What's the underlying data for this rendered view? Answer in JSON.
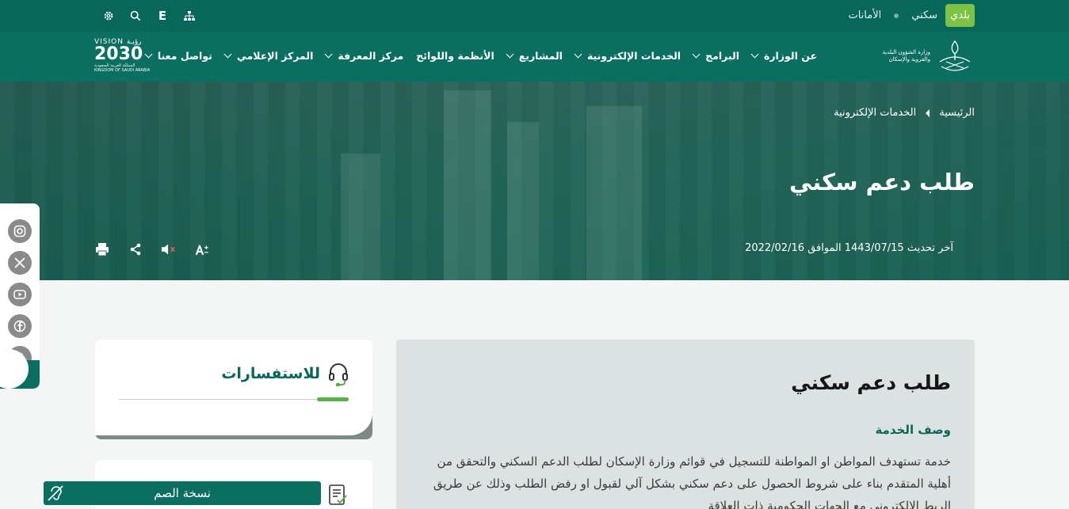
{
  "topbar": {
    "links": [
      {
        "label": "بلدي",
        "active": true
      },
      {
        "label": "سكني",
        "active": false
      },
      {
        "label": "الأمانات",
        "active": false
      }
    ],
    "tools": [
      "settings-icon",
      "search-icon",
      "english-icon",
      "sitemap-icon"
    ],
    "english_label": "E"
  },
  "navbar": {
    "ministry_logo_text": "وزارة الشؤون البلدية والقروية والإسكان",
    "vision": {
      "top": "VISION رؤيـة",
      "year": "2030",
      "bottom": "المملكة العربية السعودية KINGDOM OF SAUDI ARABIA"
    },
    "menu": [
      {
        "label": "عن الوزارة",
        "dropdown": true
      },
      {
        "label": "البرامج",
        "dropdown": true
      },
      {
        "label": "الخدمات الإلكترونية",
        "dropdown": true
      },
      {
        "label": "المشاريع",
        "dropdown": true
      },
      {
        "label": "الأنظمة واللوائح",
        "dropdown": false
      },
      {
        "label": "مركز المعرفة",
        "dropdown": true
      },
      {
        "label": "المركز الإعلامي",
        "dropdown": true
      },
      {
        "label": "تواصل معنا",
        "dropdown": true
      }
    ]
  },
  "hero": {
    "breadcrumb": [
      "الرئيسية",
      "الخدمات الإلكترونية"
    ],
    "title": "طلب دعم سكني",
    "updated": "آخر تحديث 1443/07/15 الموافق 2022/02/16"
  },
  "content": {
    "title": "طلب دعم سكني",
    "subhead": "وصف الخدمة",
    "description": "خدمة تستهدف المواطن او المواطنة للتسجيل في قوائم وزارة الإسكان لطلب الدعم السكني والتحقق من أهلية المتقدم بناء على شروط الحصول على دعم سكني بشكل آلي لقبول او رفض الطلب وذلك عن طريق الربط الالكتروني مع الجهات الحكومية ذات العلاقة"
  },
  "sidebar": {
    "enquiries_title": "للاستفسارات",
    "deaf_button": "نسخة الصم"
  },
  "colors": {
    "primary": "#0a6e60",
    "accent": "#7cc243"
  }
}
